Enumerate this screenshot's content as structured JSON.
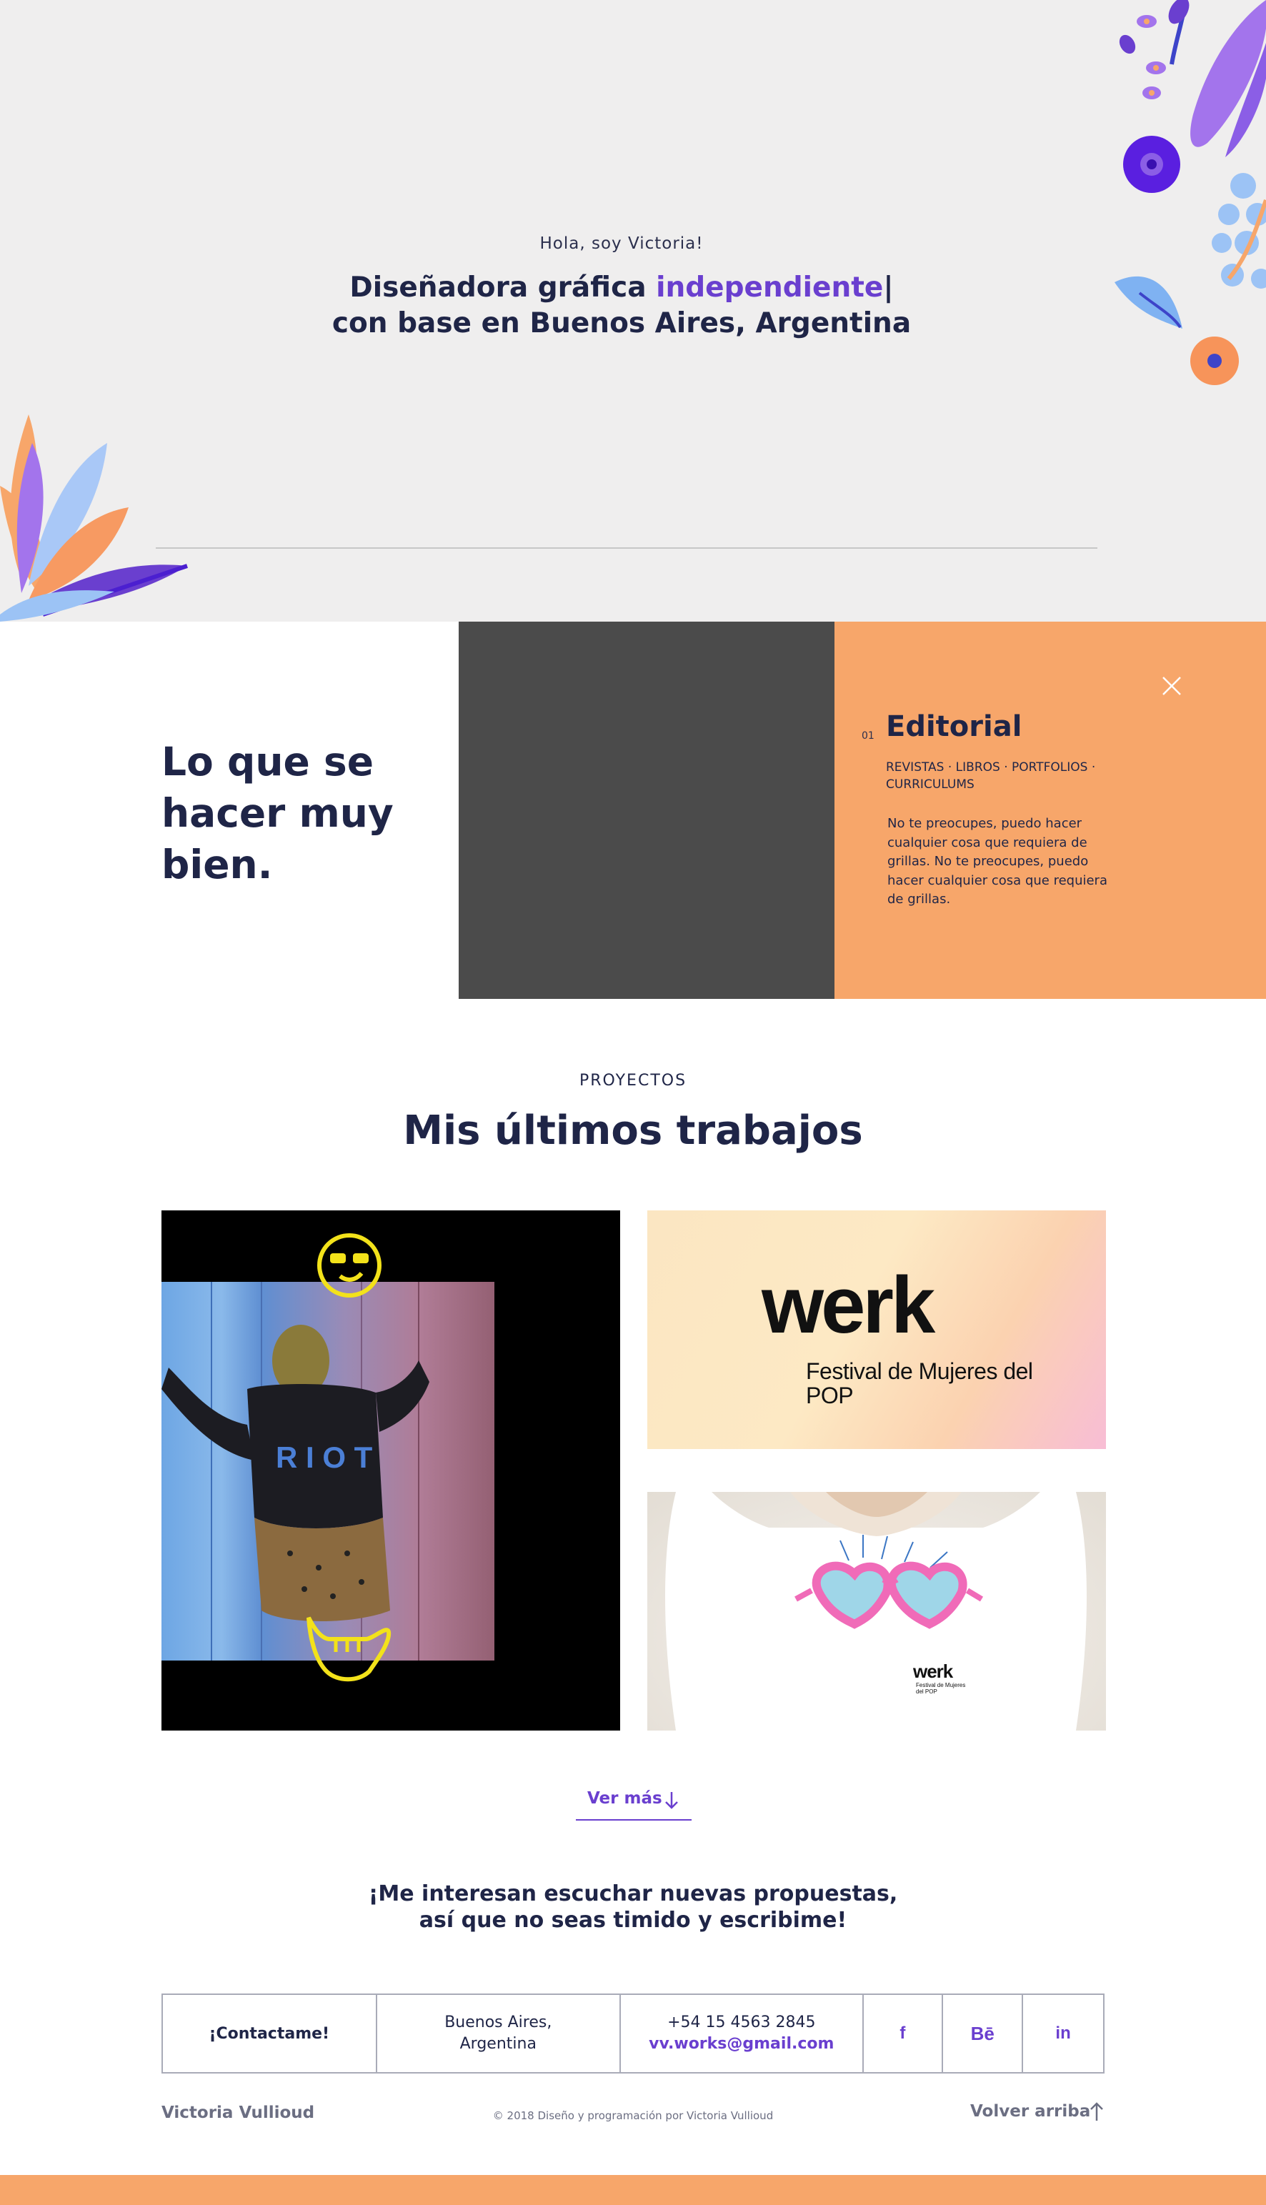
{
  "hero": {
    "greeting": "Hola, soy Victoria!",
    "title_line1_prefix": "Diseñadora gráfica ",
    "title_line1_accent": "independiente",
    "title_cursor": "|",
    "title_line2": "con base en Buenos Aires, Argentina"
  },
  "skills": {
    "heading": "Lo que se hacer muy bien.",
    "card": {
      "number": "01",
      "title": "Editorial",
      "tags": "REVISTAS · LIBROS · PORTFOLIOS · CURRICULUMS",
      "description": "No te preocupes, puedo hacer cualquier cosa que requiera de grillas. No te preocupes, puedo hacer cualquier cosa que requiera de grillas.",
      "close_icon": "close-icon"
    }
  },
  "projects": {
    "kicker": "PROYECTOS",
    "title": "Mis últimos trabajos",
    "werk": {
      "logo": "werk",
      "subtitle": "Festival de Mujeres del POP"
    },
    "shirt": {
      "logo": "werk",
      "subtitle": "Festival de Mujeres del POP"
    },
    "ver_mas": "Ver más"
  },
  "contact": {
    "prompt_line1": "¡Me interesan escuchar nuevas propuestas,",
    "prompt_line2": "así que no seas timido y escribime!",
    "cta": "¡Contactame!",
    "location": "Buenos Aires, Argentina",
    "phone": "+54 15 4563 2845",
    "email": "vv.works@gmail.com",
    "social": {
      "facebook": "f",
      "behance": "Bē",
      "linkedin": "in"
    }
  },
  "footer": {
    "name": "Victoria Vullioud",
    "copyright": "© 2018 Diseño y programación por Victoria Vullioud",
    "back_to_top": "Volver arriba"
  },
  "colors": {
    "accent": "#6a3fcf",
    "navy": "#1f2547",
    "orange": "#f7a66a",
    "hero_bg": "#efeeee"
  }
}
